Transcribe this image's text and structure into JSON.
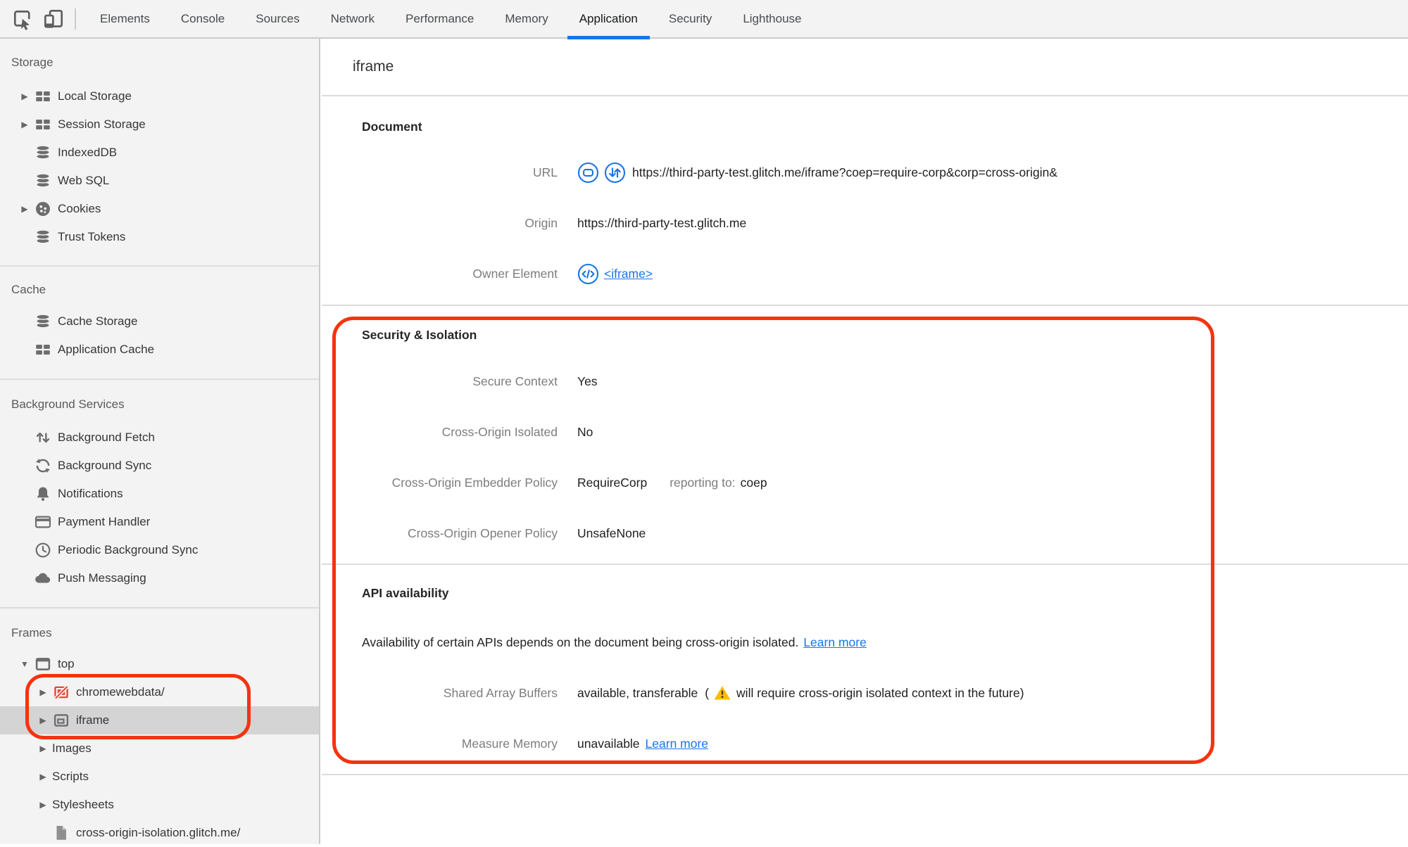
{
  "tabbar": {
    "tabs": [
      "Elements",
      "Console",
      "Sources",
      "Network",
      "Performance",
      "Memory",
      "Application",
      "Security",
      "Lighthouse"
    ],
    "selected_tab": "Application"
  },
  "icons": {
    "collapsed": "▶",
    "expanded": "▼"
  },
  "sidebar": {
    "storage": {
      "title": "Storage",
      "items": [
        "Local Storage",
        "Session Storage",
        "IndexedDB",
        "Web SQL",
        "Cookies",
        "Trust Tokens"
      ]
    },
    "cache": {
      "title": "Cache",
      "items": [
        "Cache Storage",
        "Application Cache"
      ]
    },
    "background_services": {
      "title": "Background Services",
      "items": [
        "Background Fetch",
        "Background Sync",
        "Notifications",
        "Payment Handler",
        "Periodic Background Sync",
        "Push Messaging"
      ]
    },
    "frames": {
      "title": "Frames",
      "items": [
        "top",
        "chromewebdata/",
        "iframe",
        "Images",
        "Scripts",
        "Stylesheets",
        "cross-origin-isolation.glitch.me/"
      ],
      "selected_item": "iframe"
    }
  },
  "main": {
    "title": "iframe",
    "document": {
      "heading": "Document",
      "url_label": "URL",
      "url_value": "https://third-party-test.glitch.me/iframe?coep=require-corp&corp=cross-origin&",
      "origin_label": "Origin",
      "origin_value": "https://third-party-test.glitch.me",
      "owner_label": "Owner Element",
      "owner_value": "<iframe>"
    },
    "security": {
      "heading": "Security & Isolation",
      "rows": [
        {
          "label": "Secure Context",
          "value": "Yes"
        },
        {
          "label": "Cross-Origin Isolated",
          "value": "No"
        },
        {
          "label": "Cross-Origin Embedder Policy",
          "value": "RequireCorp",
          "extra_label": "reporting to:",
          "extra_value": "coep"
        },
        {
          "label": "Cross-Origin Opener Policy",
          "value": "UnsafeNone"
        }
      ]
    },
    "api": {
      "heading": "API availability",
      "description": "Availability of certain APIs depends on the document being cross-origin isolated.",
      "learn_more": "Learn more",
      "shared_array_buffers": {
        "label": "Shared Array Buffers",
        "value": "available, transferable",
        "paren_open": "(",
        "warning": "will require cross-origin isolated context in the future",
        "paren_close": ")"
      },
      "measure_memory": {
        "label": "Measure Memory",
        "value": "unavailable",
        "link": "Learn more"
      }
    }
  },
  "colors": {
    "accent_blue": "#1a73e8",
    "annotation_red": "#f5330f",
    "warning_yellow": "#fbbc04",
    "sidebar_bg": "#f2f3f2",
    "selected_row_bg": "#d4d4d4"
  }
}
